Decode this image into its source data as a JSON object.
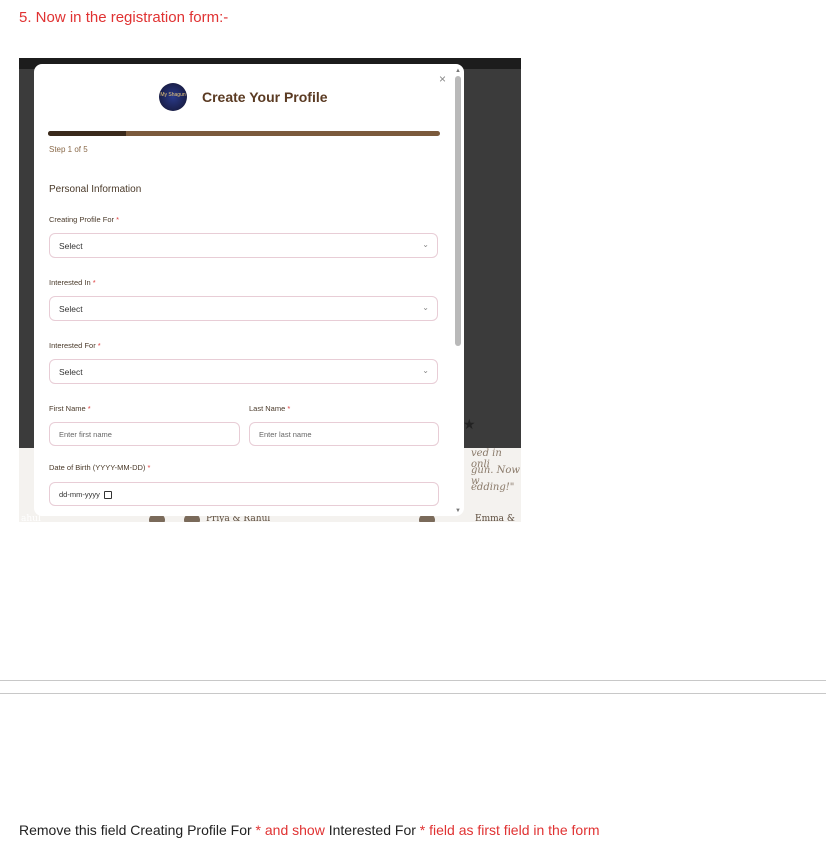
{
  "heading": "5. Now in the registration form:-",
  "screenshot": {
    "background": {
      "text_lines": [
        "ved in onli",
        "gun. Now w",
        "edding!\""
      ],
      "names": [
        "Priya & Rahul",
        "Emma &",
        "ahul"
      ]
    },
    "modal": {
      "close": "×",
      "logo_text": "My Shagun",
      "title": "Create Your Profile",
      "progress": 0.2,
      "step": "Step 1 of 5",
      "section": "Personal Information",
      "fields": {
        "creating_for": {
          "label": "Creating Profile For",
          "required": "*",
          "value": "Select"
        },
        "interested_in": {
          "label": "Interested In",
          "required": "*",
          "value": "Select"
        },
        "interested_for": {
          "label": "Interested For",
          "required": "*",
          "value": "Select"
        },
        "first_name": {
          "label": "First Name",
          "required": "*",
          "placeholder": "Enter first name"
        },
        "last_name": {
          "label": "Last Name",
          "required": "*",
          "placeholder": "Enter last name"
        },
        "dob": {
          "label": "Date of Birth (YYYY-MM-DD)",
          "required": "*",
          "placeholder": "dd-mm-yyyy"
        }
      },
      "chevron": "⌄"
    }
  },
  "note": {
    "part1": "Remove this field ",
    "part2": "Creating Profile For",
    "part3": " * and show ",
    "part4": "Interested For",
    "part5": " * field as first field in the form"
  }
}
